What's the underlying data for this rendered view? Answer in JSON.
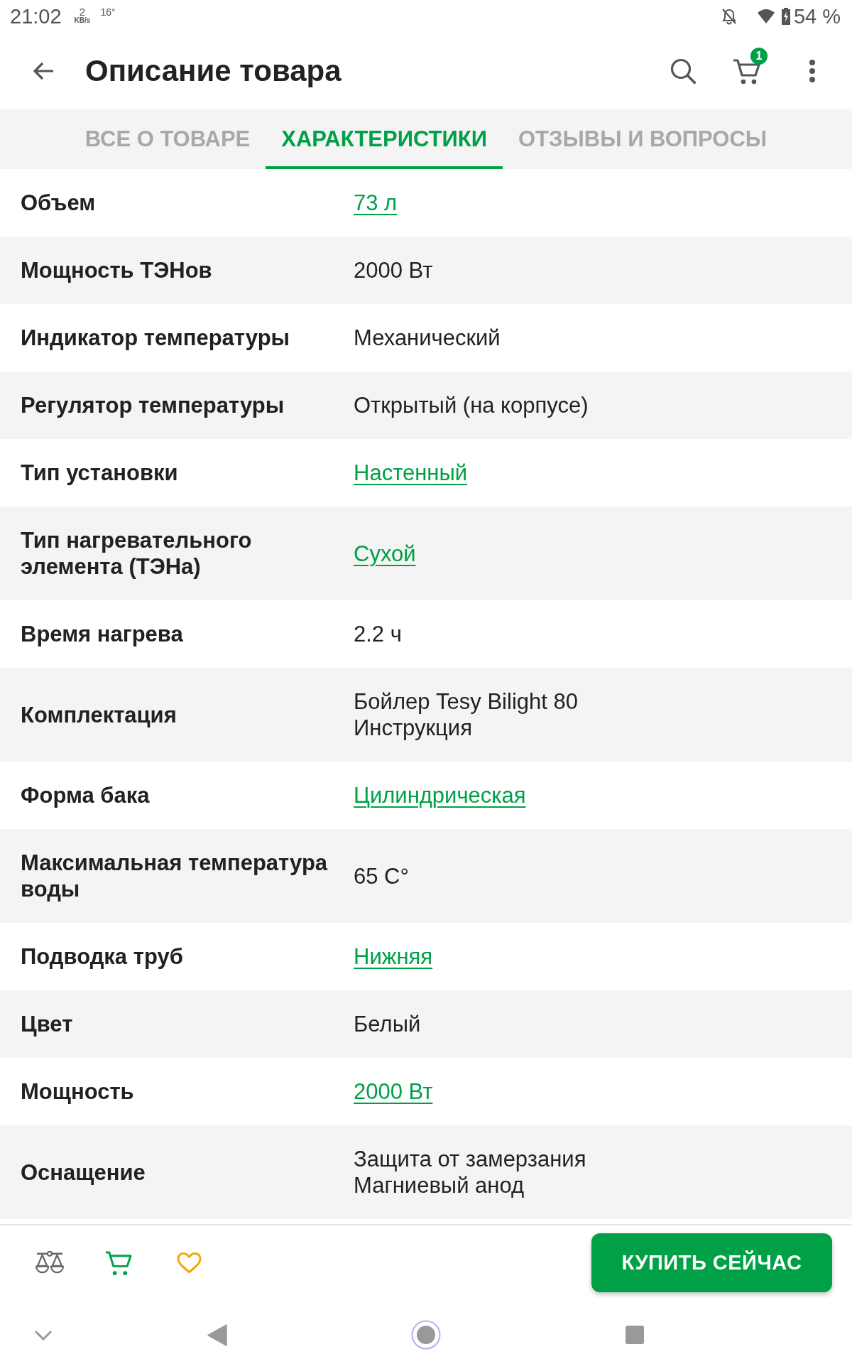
{
  "status_bar": {
    "time": "21:02",
    "speed_value": "2",
    "speed_unit": "KB/s",
    "temperature": "16°",
    "battery": "54 %"
  },
  "header": {
    "title": "Описание товара",
    "cart_count": "1"
  },
  "tabs": [
    {
      "label": "ВСЕ О ТОВАРЕ",
      "selected": false
    },
    {
      "label": "ХАРАКТЕРИСТИКИ",
      "selected": true
    },
    {
      "label": "ОТЗЫВЫ И ВОПРОСЫ",
      "selected": false
    }
  ],
  "specs": [
    {
      "name": "Объем",
      "values": [
        "73 л"
      ],
      "link": true
    },
    {
      "name": "Мощность ТЭНов",
      "values": [
        "2000 Вт"
      ],
      "link": false
    },
    {
      "name": "Индикатор температуры",
      "values": [
        "Механический"
      ],
      "link": false
    },
    {
      "name": "Регулятор температуры",
      "values": [
        "Открытый (на корпусе)"
      ],
      "link": false
    },
    {
      "name": "Тип установки",
      "values": [
        "Настенный"
      ],
      "link": true
    },
    {
      "name": "Тип нагревательного элемента (ТЭНа)",
      "values": [
        "Сухой"
      ],
      "link": true
    },
    {
      "name": "Время нагрева",
      "values": [
        "2.2 ч"
      ],
      "link": false
    },
    {
      "name": "Комплектация",
      "values": [
        "Бойлер Tesy Bilight 80",
        "Инструкция"
      ],
      "link": false
    },
    {
      "name": "Форма бака",
      "values": [
        "Цилиндрическая"
      ],
      "link": true
    },
    {
      "name": "Максимальная температура воды",
      "values": [
        "65 C°"
      ],
      "link": false
    },
    {
      "name": "Подводка труб",
      "values": [
        "Нижняя"
      ],
      "link": true
    },
    {
      "name": "Цвет",
      "values": [
        "Белый"
      ],
      "link": false
    },
    {
      "name": "Мощность",
      "values": [
        "2000 Вт"
      ],
      "link": true
    },
    {
      "name": "Оснащение",
      "values": [
        "Защита от замерзания",
        "Магниевый анод"
      ],
      "link": false
    }
  ],
  "action_bar": {
    "buy_button": "КУПИТЬ СЕЙЧАС"
  }
}
